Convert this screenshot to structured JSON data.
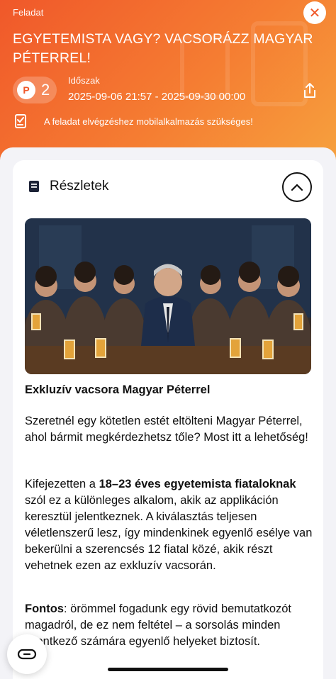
{
  "header": {
    "section_label": "Feladat",
    "title": "EGYETEMISTA VAGY? VACSORÁZZ MAGYAR PÉTERREL!",
    "points": "2",
    "points_coin": "P",
    "period_label": "Időszak",
    "period_value": "2025-09-06 21:57 - 2025-09-30 00:00",
    "notice": "A feladat elvégzéshez mobilalkalmazás szükséges!"
  },
  "details": {
    "label": "Részletek",
    "subheading": "Exkluzív vacsora Magyar Péterrel",
    "paragraph1": "Szeretnél egy kötetlen estét eltölteni Magyar Péterrel, ahol bármit megkérdezhetsz tőle? Most itt a lehetőség!",
    "paragraph2_pre": "Kifejezetten a ",
    "paragraph2_bold": "18–23 éves egyetemista fiataloknak",
    "paragraph2_post": " szól ez a különleges alkalom, akik az applikáción keresztül jelentkeznek. A kiválasztás teljesen véletlenszerű lesz, így mindenkinek egyenlő esélye van bekerülni a szerencsés 12 fiatal közé, akik részt vehetnek ezen az exkluzív vacsorán.",
    "paragraph3_bold": "Fontos",
    "paragraph3_post": ": örömmel fogadunk egy rövid bemutatkozót magadról, de ez nem feltétel – a sorsolás minden jelentkező számára egyenlő helyeket biztosít."
  },
  "icons": {
    "close": "close-icon",
    "coin": "points-coin-icon",
    "share": "share-icon",
    "notice": "checklist-icon",
    "details": "notebook-icon",
    "collapse": "chevron-up-icon",
    "chat": "chat-icon"
  },
  "colors": {
    "accent": "#f0582a",
    "accent_light": "#f6a23e",
    "sheet_bg": "#f3f3f7"
  }
}
